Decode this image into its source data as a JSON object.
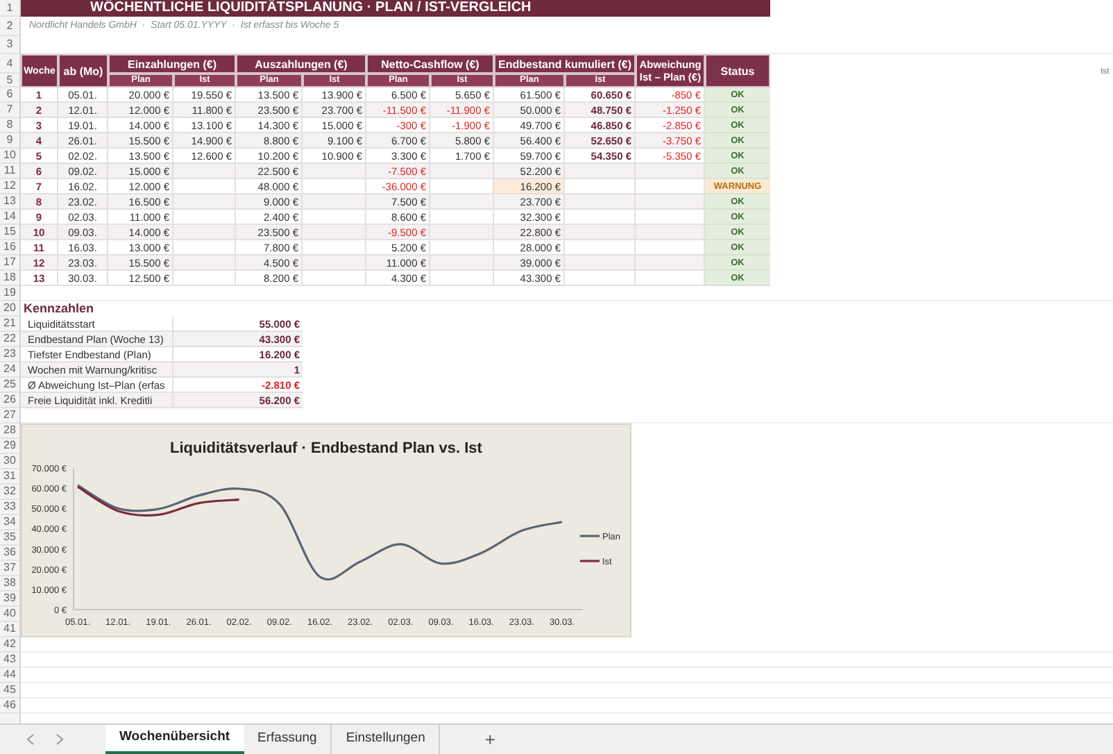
{
  "title": "WÖCHENTLICHE LIQUIDITÄTSPLANUNG · PLAN / IST-VERGLEICH",
  "subtitle": "Nordlicht Handels GmbH  ·  Start 05.01.YYYY  ·  Ist erfasst bis Woche 5",
  "row_numbers": [
    "1",
    "2",
    "3",
    "4",
    "5",
    "6",
    "7",
    "8",
    "9",
    "10",
    "11",
    "12",
    "13",
    "14",
    "15",
    "16",
    "17",
    "18",
    "19",
    "20",
    "21",
    "22",
    "23",
    "24",
    "25",
    "26",
    "27",
    "28",
    "29",
    "30",
    "31",
    "32",
    "33",
    "34",
    "35",
    "36",
    "37",
    "38",
    "39",
    "40",
    "41",
    "42",
    "43",
    "44",
    "45",
    "46"
  ],
  "table": {
    "columns": {
      "week": "Woche",
      "date": "ab (Mo)",
      "groups": [
        {
          "label": "Einzahlungen (€)",
          "sub": [
            "Plan",
            "Ist"
          ]
        },
        {
          "label": "Auszahlungen (€)",
          "sub": [
            "Plan",
            "Ist"
          ]
        },
        {
          "label": "Netto-Cashflow (€)",
          "sub": [
            "Plan",
            "Ist"
          ]
        },
        {
          "label": "Endbestand kumuliert (€)",
          "sub": [
            "Plan",
            "Ist"
          ]
        }
      ],
      "deviation": [
        "Abweichung",
        "Ist – Plan (€)"
      ],
      "status": "Status"
    },
    "rows": [
      {
        "week": "1",
        "date": "05.01.",
        "in_plan": "20.000 €",
        "in_ist": "19.550 €",
        "out_plan": "13.500 €",
        "out_ist": "13.900 €",
        "net_plan": "6.500 €",
        "net_plan_negative": false,
        "net_ist": "5.650 €",
        "net_ist_negative": false,
        "end_plan": "61.500 €",
        "end_ist": "60.650 €",
        "deviation": "-850 €",
        "status": "OK",
        "warning": false
      },
      {
        "week": "2",
        "date": "12.01.",
        "in_plan": "12.000 €",
        "in_ist": "11.800 €",
        "out_plan": "23.500 €",
        "out_ist": "23.700 €",
        "net_plan": "-11.500 €",
        "net_plan_negative": true,
        "net_ist": "-11.900 €",
        "net_ist_negative": true,
        "end_plan": "50.000 €",
        "end_ist": "48.750 €",
        "deviation": "-1.250 €",
        "status": "OK",
        "warning": false
      },
      {
        "week": "3",
        "date": "19.01.",
        "in_plan": "14.000 €",
        "in_ist": "13.100 €",
        "out_plan": "14.300 €",
        "out_ist": "15.000 €",
        "net_plan": "-300 €",
        "net_plan_negative": true,
        "net_ist": "-1.900 €",
        "net_ist_negative": true,
        "end_plan": "49.700 €",
        "end_ist": "46.850 €",
        "deviation": "-2.850 €",
        "status": "OK",
        "warning": false
      },
      {
        "week": "4",
        "date": "26.01.",
        "in_plan": "15.500 €",
        "in_ist": "14.900 €",
        "out_plan": "8.800 €",
        "out_ist": "9.100 €",
        "net_plan": "6.700 €",
        "net_plan_negative": false,
        "net_ist": "5.800 €",
        "net_ist_negative": false,
        "end_plan": "56.400 €",
        "end_ist": "52.650 €",
        "deviation": "-3.750 €",
        "status": "OK",
        "warning": false
      },
      {
        "week": "5",
        "date": "02.02.",
        "in_plan": "13.500 €",
        "in_ist": "12.600 €",
        "out_plan": "10.200 €",
        "out_ist": "10.900 €",
        "net_plan": "3.300 €",
        "net_plan_negative": false,
        "net_ist": "1.700 €",
        "net_ist_negative": false,
        "end_plan": "59.700 €",
        "end_ist": "54.350 €",
        "deviation": "-5.350 €",
        "status": "OK",
        "warning": false
      },
      {
        "week": "6",
        "date": "09.02.",
        "in_plan": "15.000 €",
        "out_plan": "22.500 €",
        "net_plan": "-7.500 €",
        "net_plan_negative": true,
        "end_plan": "52.200 €",
        "status": "OK",
        "warning": false
      },
      {
        "week": "7",
        "date": "16.02.",
        "in_plan": "12.000 €",
        "out_plan": "48.000 €",
        "net_plan": "-36.000 €",
        "net_plan_negative": true,
        "end_plan": "16.200 €",
        "status": "WARNUNG",
        "warning": true
      },
      {
        "week": "8",
        "date": "23.02.",
        "in_plan": "16.500 €",
        "out_plan": "9.000 €",
        "net_plan": "7.500 €",
        "net_plan_negative": false,
        "end_plan": "23.700 €",
        "status": "OK",
        "warning": false
      },
      {
        "week": "9",
        "date": "02.03.",
        "in_plan": "11.000 €",
        "out_plan": "2.400 €",
        "net_plan": "8.600 €",
        "net_plan_negative": false,
        "end_plan": "32.300 €",
        "status": "OK",
        "warning": false
      },
      {
        "week": "10",
        "date": "09.03.",
        "in_plan": "14.000 €",
        "out_plan": "23.500 €",
        "net_plan": "-9.500 €",
        "net_plan_negative": true,
        "end_plan": "22.800 €",
        "status": "OK",
        "warning": false
      },
      {
        "week": "11",
        "date": "16.03.",
        "in_plan": "13.000 €",
        "out_plan": "7.800 €",
        "net_plan": "5.200 €",
        "net_plan_negative": false,
        "end_plan": "28.000 €",
        "status": "OK",
        "warning": false
      },
      {
        "week": "12",
        "date": "23.03.",
        "in_plan": "15.500 €",
        "out_plan": "4.500 €",
        "net_plan": "11.000 €",
        "net_plan_negative": false,
        "end_plan": "39.000 €",
        "status": "OK",
        "warning": false
      },
      {
        "week": "13",
        "date": "30.03.",
        "in_plan": "12.500 €",
        "out_plan": "8.200 €",
        "net_plan": "4.300 €",
        "net_plan_negative": false,
        "end_plan": "43.300 €",
        "status": "OK",
        "warning": false
      }
    ]
  },
  "kennzahlen": {
    "title": "Kennzahlen",
    "items": [
      {
        "label": "Liquiditätsstart",
        "value": "55.000 €",
        "negative": false
      },
      {
        "label": "Endbestand Plan (Woche 13)",
        "value": "43.300 €",
        "negative": false
      },
      {
        "label": "Tiefster Endbestand (Plan)",
        "value": "16.200 €",
        "negative": false
      },
      {
        "label": "Wochen mit Warnung/kritisc",
        "value": "1",
        "negative": false
      },
      {
        "label": "Ø Abweichung Ist–Plan (erfas",
        "value": "-2.810 €",
        "negative": true
      },
      {
        "label": "Freie Liquidität inkl. Kreditli",
        "value": "56.200 €",
        "negative": false
      }
    ]
  },
  "chart": {
    "chart_data": {
      "type": "line",
      "title": "Liquiditätsverlauf · Endbestand Plan vs. Ist",
      "categories": [
        "05.01.",
        "12.01.",
        "19.01.",
        "26.01.",
        "02.02.",
        "09.02.",
        "16.02.",
        "23.02.",
        "02.03.",
        "09.03.",
        "16.03.",
        "23.03.",
        "30.03."
      ],
      "series": [
        {
          "name": "Plan",
          "color": "#5b6473",
          "values": [
            61500,
            50000,
            49700,
            56400,
            59700,
            52200,
            16200,
            23700,
            32300,
            22800,
            28000,
            39000,
            43300
          ]
        },
        {
          "name": "Ist",
          "color": "#7a2b3e",
          "values": [
            60650,
            48750,
            46850,
            52650,
            54350,
            null,
            null,
            null,
            null,
            null,
            null,
            null,
            null
          ]
        }
      ],
      "legend": true,
      "ylim": [
        0,
        70000
      ],
      "yticks": [
        {
          "value": 0,
          "label": "0 €"
        },
        {
          "value": 10000,
          "label": "10.000 €"
        },
        {
          "value": 20000,
          "label": "20.000 €"
        },
        {
          "value": 30000,
          "label": "30.000 €"
        },
        {
          "value": 40000,
          "label": "40.000 €"
        },
        {
          "value": 50000,
          "label": "50.000 €"
        },
        {
          "value": 60000,
          "label": "60.000 €"
        },
        {
          "value": 70000,
          "label": "70.000 €"
        }
      ]
    }
  },
  "side_note": "Ist",
  "sheet_tabs": [
    {
      "label": "Wochenübersicht",
      "selected": true
    },
    {
      "label": "Erfassung",
      "selected": false
    },
    {
      "label": "Einstellungen",
      "selected": false
    }
  ],
  "add_sheet": "+"
}
